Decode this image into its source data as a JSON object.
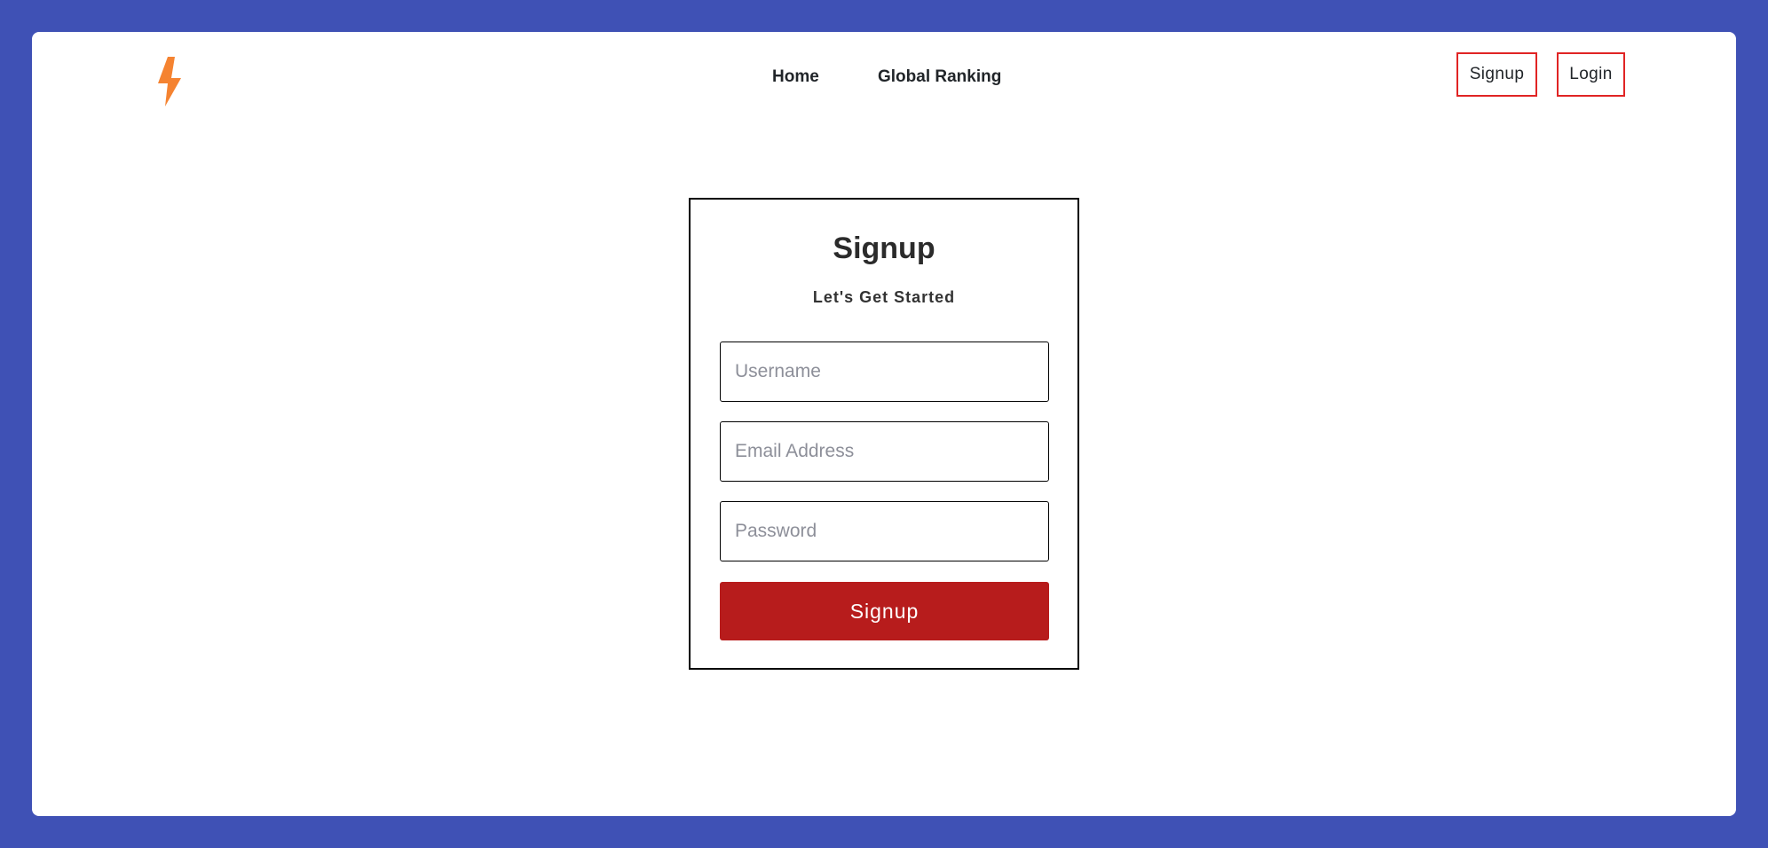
{
  "brand": {
    "logo_icon": "lightning-bolt-icon",
    "logo_color": "#f58331"
  },
  "nav": {
    "links": [
      {
        "label": "Home"
      },
      {
        "label": "Global Ranking"
      }
    ],
    "signup_label": "Signup",
    "login_label": "Login",
    "auth_border_color": "#e02424"
  },
  "form": {
    "title": "Signup",
    "subtitle": "Let's Get Started",
    "username_placeholder": "Username",
    "email_placeholder": "Email Address",
    "password_placeholder": "Password",
    "submit_label": "Signup",
    "submit_color": "#b71c1c"
  },
  "theme": {
    "background_color": "#3f51b5"
  }
}
